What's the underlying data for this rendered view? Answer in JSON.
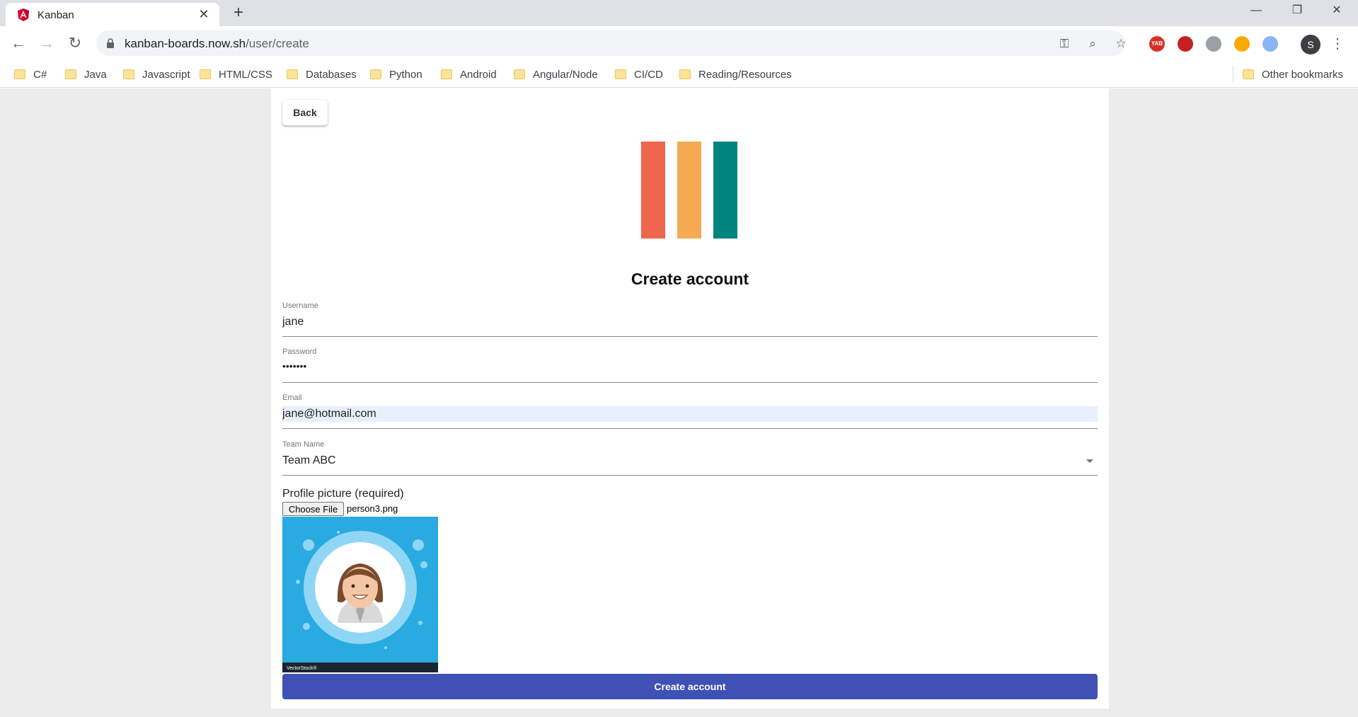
{
  "browser": {
    "tab_title": "Kanban",
    "url_host": "kanban-boards.now.sh",
    "url_path": "/user/create",
    "profile_initial": "S",
    "extensions": [
      {
        "name": "yab-extension-icon",
        "label": "YAB",
        "color": "#d93025"
      },
      {
        "name": "pdf-extension-icon",
        "label": "",
        "color": "#c5221f"
      },
      {
        "name": "gear-extension-icon",
        "label": "",
        "color": "#9aa0a6"
      },
      {
        "name": "moon-extension-icon",
        "label": "",
        "color": "#f9ab00"
      },
      {
        "name": "blue-extension-icon",
        "label": "",
        "color": "#8ab4f8"
      }
    ]
  },
  "bookmarks": {
    "items": [
      "C#",
      "Java",
      "Javascript",
      "HTML/CSS",
      "Databases",
      "Python",
      "Android",
      "Angular/Node",
      "CI/CD",
      "Reading/Resources"
    ],
    "other": "Other bookmarks"
  },
  "page": {
    "back_label": "Back",
    "logo_colors": [
      "#f0654e",
      "#f5a952",
      "#00847f"
    ],
    "title": "Create account",
    "username": {
      "label": "Username",
      "value": "jane"
    },
    "password": {
      "label": "Password",
      "value": "•••••••"
    },
    "email": {
      "label": "Email",
      "value": "jane@hotmail.com"
    },
    "team": {
      "label": "Team Name",
      "value": "Team ABC"
    },
    "picture_label": "Profile picture (required)",
    "file_button_label": "Choose File",
    "file_name": "person3.png",
    "watermark": "VectorStock®",
    "submit_label": "Create account"
  },
  "colors": {
    "primary": "#3f51b5",
    "avatar_background": "#29abe2"
  }
}
